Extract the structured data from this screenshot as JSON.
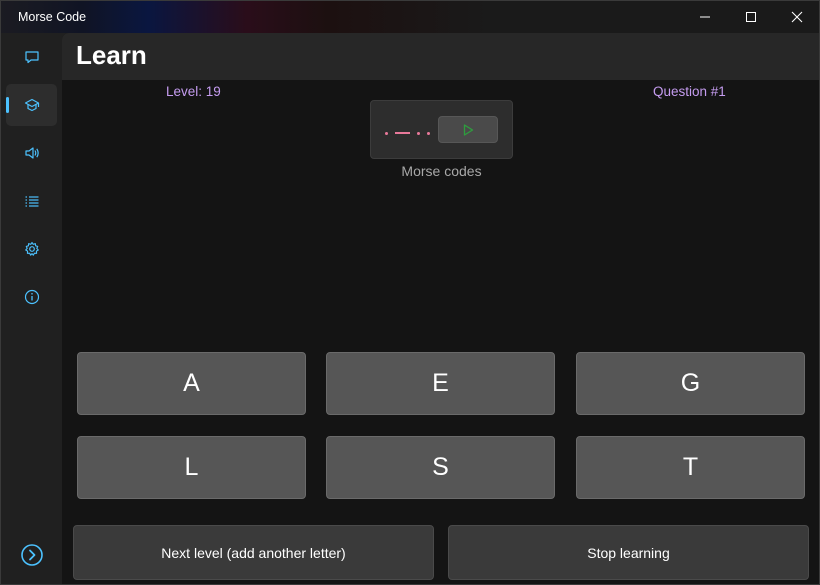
{
  "window": {
    "title": "Morse Code"
  },
  "sidebar": {
    "items": [
      {
        "icon": "chat-icon"
      },
      {
        "icon": "learn-icon",
        "selected": true
      },
      {
        "icon": "speaker-icon"
      },
      {
        "icon": "list-icon"
      },
      {
        "icon": "gear-icon"
      },
      {
        "icon": "info-icon"
      }
    ],
    "expand_icon": "chevron-right-circle-icon"
  },
  "header": {
    "title": "Learn"
  },
  "learn": {
    "level": "Level: 19",
    "question": "Question #1",
    "morse_caption": "Morse codes",
    "morse_pattern": [
      "dot",
      "dash",
      "dot",
      "dot"
    ],
    "letters": [
      "A",
      "E",
      "G",
      "L",
      "S",
      "T"
    ],
    "next_level_label": "Next level (add another letter)",
    "stop_label": "Stop learning"
  },
  "colors": {
    "accent": "#4cc2ff",
    "info_text": "#c59cf0",
    "morse_symbol": "#e8799a",
    "play_icon": "#2e9d3e"
  }
}
